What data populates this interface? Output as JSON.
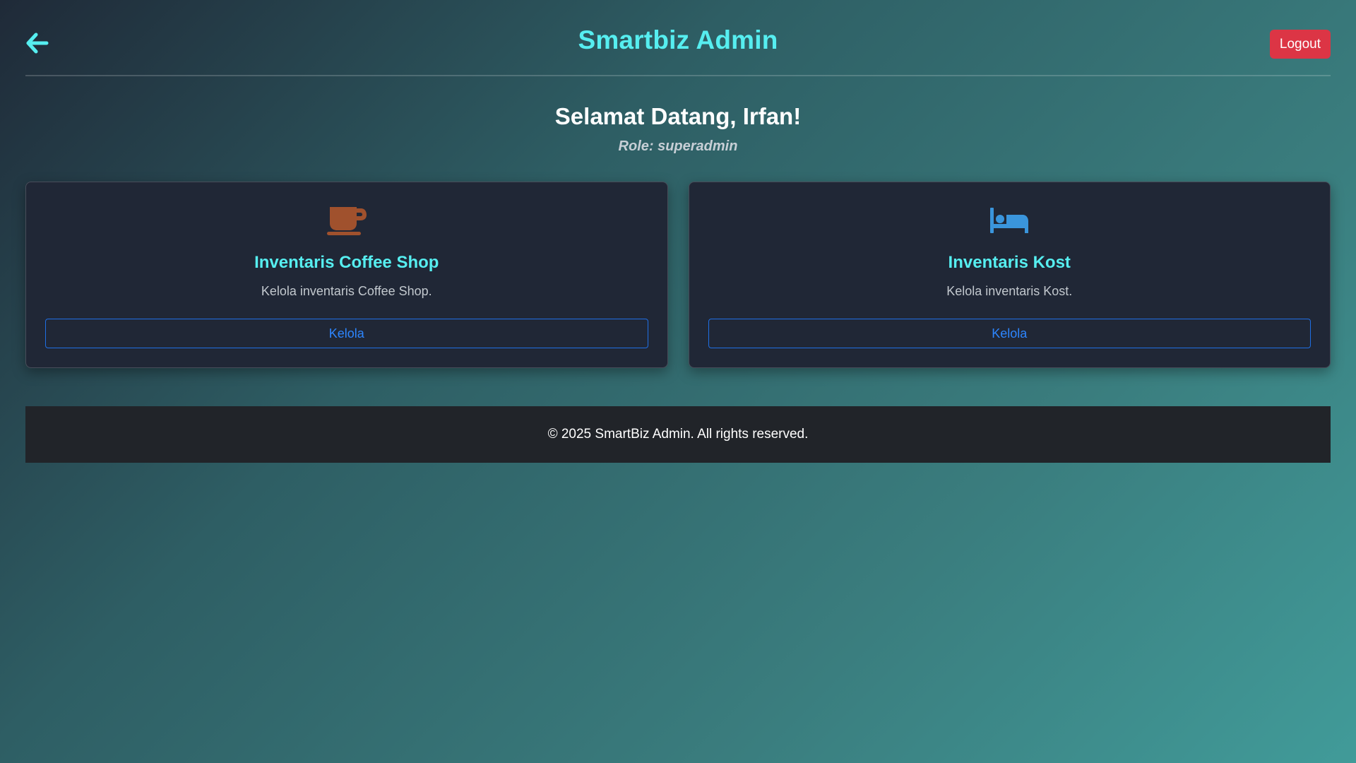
{
  "header": {
    "back_icon": "arrow-left-icon",
    "title": "Smartbiz Admin",
    "logout_label": "Logout"
  },
  "welcome": {
    "greeting": "Selamat Datang, Irfan!",
    "role": "Role: superadmin"
  },
  "cards": [
    {
      "icon": "coffee-cup-icon",
      "icon_color": "#a0512d",
      "title": "Inventaris Coffee Shop",
      "description": "Kelola inventaris Coffee Shop.",
      "button_label": "Kelola"
    },
    {
      "icon": "bed-icon",
      "icon_color": "#3a95dc",
      "title": "Inventaris Kost",
      "description": "Kelola inventaris Kost.",
      "button_label": "Kelola"
    }
  ],
  "footer": {
    "text": "© 2025 SmartBiz Admin. All rights reserved."
  },
  "colors": {
    "accent": "#56eef0",
    "danger": "#dc3545",
    "link": "#2d86ff",
    "card_bg": "#202736",
    "footer_bg": "#212429"
  }
}
